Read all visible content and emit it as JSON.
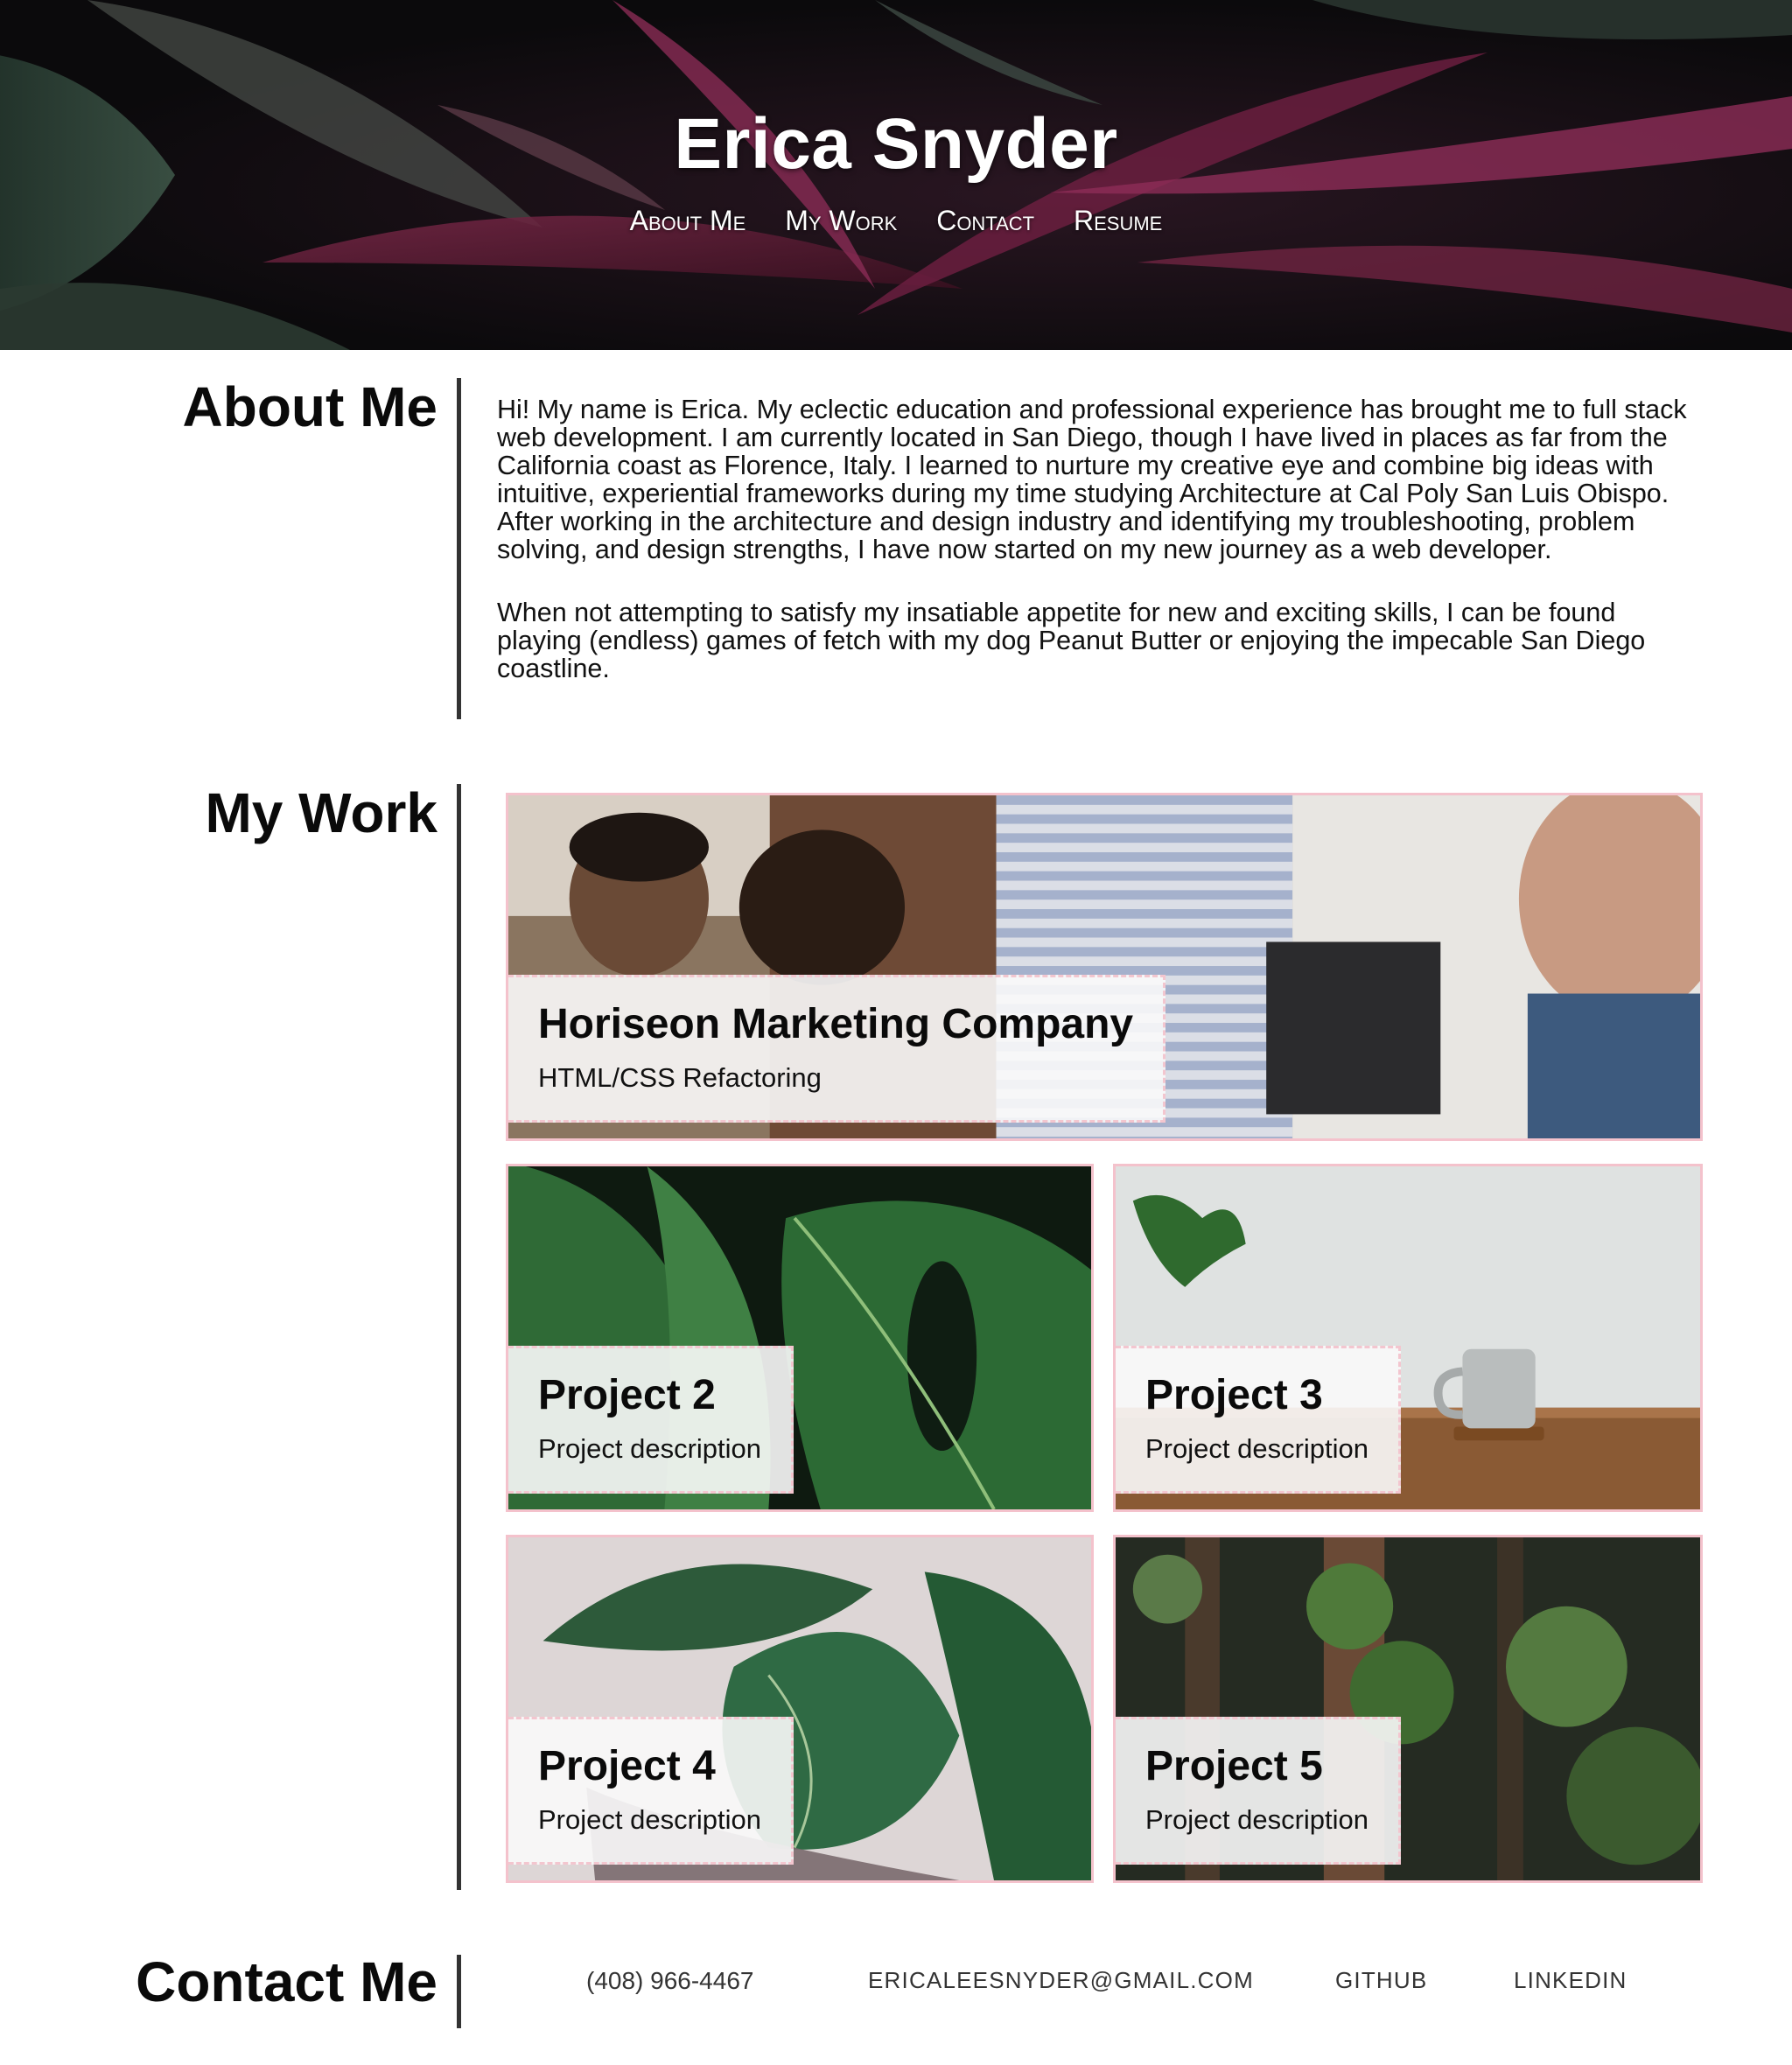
{
  "header": {
    "title": "Erica Snyder",
    "nav": [
      "About Me",
      "My Work",
      "Contact",
      "Resume"
    ]
  },
  "about": {
    "heading": "About Me",
    "paragraphs": [
      "Hi! My name is Erica. My eclectic education and professional experience has brought me to full stack web development. I am currently located in San Diego, though I have lived in places as far from the California coast as Florence, Italy. I learned to nurture my creative eye and combine big ideas with intuitive, experiential frameworks during my time studying Architecture at Cal Poly San Luis Obispo. After working in the architecture and design industry and identifying my troubleshooting, problem solving, and design strengths, I have now started on my new journey as a web developer.",
      "When not attempting to satisfy my insatiable appetite for new and exciting skills, I can be found playing (endless) games of fetch with my dog Peanut Butter or enjoying the impecable San Diego coastline."
    ]
  },
  "work": {
    "heading": "My Work",
    "projects": [
      {
        "title": "Horiseon Marketing Company",
        "description": "HTML/CSS Refactoring"
      },
      {
        "title": "Project 2",
        "description": "Project description"
      },
      {
        "title": "Project 3",
        "description": "Project description"
      },
      {
        "title": "Project 4",
        "description": "Project description"
      },
      {
        "title": "Project 5",
        "description": "Project description"
      }
    ]
  },
  "contact": {
    "heading": "Contact Me",
    "phone": "(408) 966-4467",
    "email": "ericaleesnyder@gmail.com",
    "github": "GitHub",
    "linkedin": "LinkedIn"
  },
  "colors": {
    "card_border": "#f4c2cc",
    "divider": "#333333"
  }
}
